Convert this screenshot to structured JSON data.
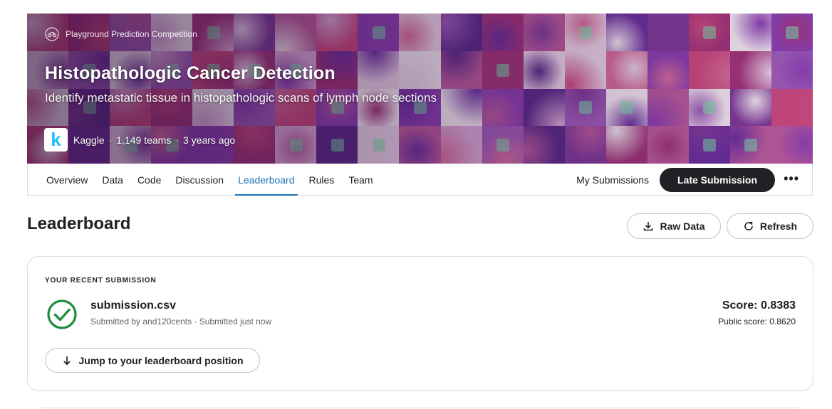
{
  "banner": {
    "competition_type": "Playground Prediction Competition",
    "title": "Histopathologic Cancer Detection",
    "subtitle": "Identify metastatic tissue in histopathologic scans of lymph node sections",
    "host_logo_letter": "k",
    "host": "Kaggle",
    "teams": "1,149 teams",
    "age": "3 years ago",
    "separator": "·"
  },
  "tabs": [
    {
      "label": "Overview"
    },
    {
      "label": "Data"
    },
    {
      "label": "Code"
    },
    {
      "label": "Discussion"
    },
    {
      "label": "Leaderboard",
      "active": true
    },
    {
      "label": "Rules"
    },
    {
      "label": "Team"
    }
  ],
  "nav_actions": {
    "my_submissions": "My Submissions",
    "late_submission": "Late Submission",
    "more": "•••"
  },
  "leaderboard": {
    "title": "Leaderboard",
    "raw_data": "Raw Data",
    "refresh": "Refresh"
  },
  "recent_submission": {
    "label": "YOUR RECENT SUBMISSION",
    "file_name": "submission.csv",
    "meta": "Submitted by and120cents · Submitted just now",
    "score": "Score: 0.8383",
    "public_score": "Public score: 0.8620",
    "jump_button": "Jump to your leaderboard position",
    "status_icon": "check-circle-icon"
  },
  "colors": {
    "accent": "#1a73b8",
    "success": "#1e8e3e",
    "primary_button": "#202124"
  }
}
